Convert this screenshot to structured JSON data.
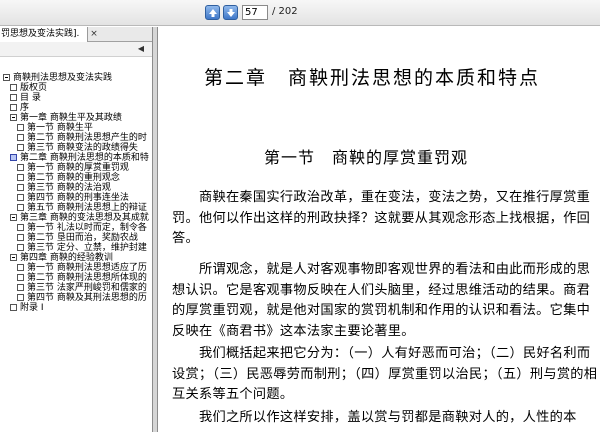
{
  "toolbar": {
    "page_value": "57",
    "page_total": "/ 202"
  },
  "tab": {
    "label": "罚思想及变法实践].",
    "close": "×"
  },
  "tree": [
    {
      "label": "商鞅刑法思想及变法实践",
      "indent": 0,
      "box": "minus"
    },
    {
      "label": "版权页",
      "indent": 1,
      "box": "plain"
    },
    {
      "label": "目 录",
      "indent": 1,
      "box": "plain"
    },
    {
      "label": "序",
      "indent": 1,
      "box": "plain"
    },
    {
      "label": "第一章  商鞅生平及其政绩",
      "indent": 1,
      "box": "minus"
    },
    {
      "label": "第一节  商鞅生平",
      "indent": 2,
      "box": "plain"
    },
    {
      "label": "第二节  商鞅刑法思想产生的时",
      "indent": 2,
      "box": "plain"
    },
    {
      "label": "第三节  商鞅变法的政绩得失",
      "indent": 2,
      "box": "plain"
    },
    {
      "label": "第二章  商鞅刑法思想的本质和特",
      "indent": 1,
      "box": "sel"
    },
    {
      "label": "第一节  商鞅的厚赏重罚观",
      "indent": 2,
      "box": "plain"
    },
    {
      "label": "第二节  商鞅的重刑观念",
      "indent": 2,
      "box": "plain"
    },
    {
      "label": "第三节  商鞅的法治观",
      "indent": 2,
      "box": "plain"
    },
    {
      "label": "第四节  商鞅的刑事连坐法",
      "indent": 2,
      "box": "plain"
    },
    {
      "label": "第五节  商鞅刑法思想上的辩证",
      "indent": 2,
      "box": "plain"
    },
    {
      "label": "第三章  商鞅的变法思想及其成就",
      "indent": 1,
      "box": "minus"
    },
    {
      "label": "第一节  礼法以时而定，制令各",
      "indent": 2,
      "box": "plain"
    },
    {
      "label": "第二节  垦田而治，奖励农战",
      "indent": 2,
      "box": "plain"
    },
    {
      "label": "第三节  定分、立禁，维护封建",
      "indent": 2,
      "box": "plain"
    },
    {
      "label": "第四章  商鞅的经验教训",
      "indent": 1,
      "box": "minus"
    },
    {
      "label": "第一节  商鞅刑法思想适应了历",
      "indent": 2,
      "box": "plain"
    },
    {
      "label": "第二节  商鞅刑法思想所体现的",
      "indent": 2,
      "box": "plain"
    },
    {
      "label": "第三节  法家严刑峻罚和儒家的",
      "indent": 2,
      "box": "plain"
    },
    {
      "label": "第四节  商鞅及其刑法思想的历",
      "indent": 2,
      "box": "plain"
    },
    {
      "label": "附录 I",
      "indent": 1,
      "box": "plain"
    }
  ],
  "document": {
    "chapter_title": "第二章　商鞅刑法思想的本质和特点",
    "section_title": "第一节　商鞅的厚赏重罚观",
    "paragraphs": [
      "　　商鞅在秦国实行政治改革，重在变法，变法之势，又在推行厚赏重罚。他何以作出这样的刑政抉择？这就要从其观念形态上找根据，作回答。",
      "　　所谓观念，就是人对客观事物即客观世界的看法和由此而形成的思想认识。它是客观事物反映在人们头脑里，经过思维活动的结果。商君的厚赏重罚观，就是他对国家的赏罚机制和作用的认识和看法。它集中反映在《商君书》这本法家主要论著里。",
      "　　我们概括起来把它分为：（一）人有好恶而可治；（二）民好名利而设赏；（三）民恶辱劳而制刑；（四）厚赏重罚以治民；（五）刑与赏的相互关系等五个问题。",
      "　　我们之所以作这样安排，盖以赏与罚都是商鞅对人的，人性的本"
    ]
  }
}
